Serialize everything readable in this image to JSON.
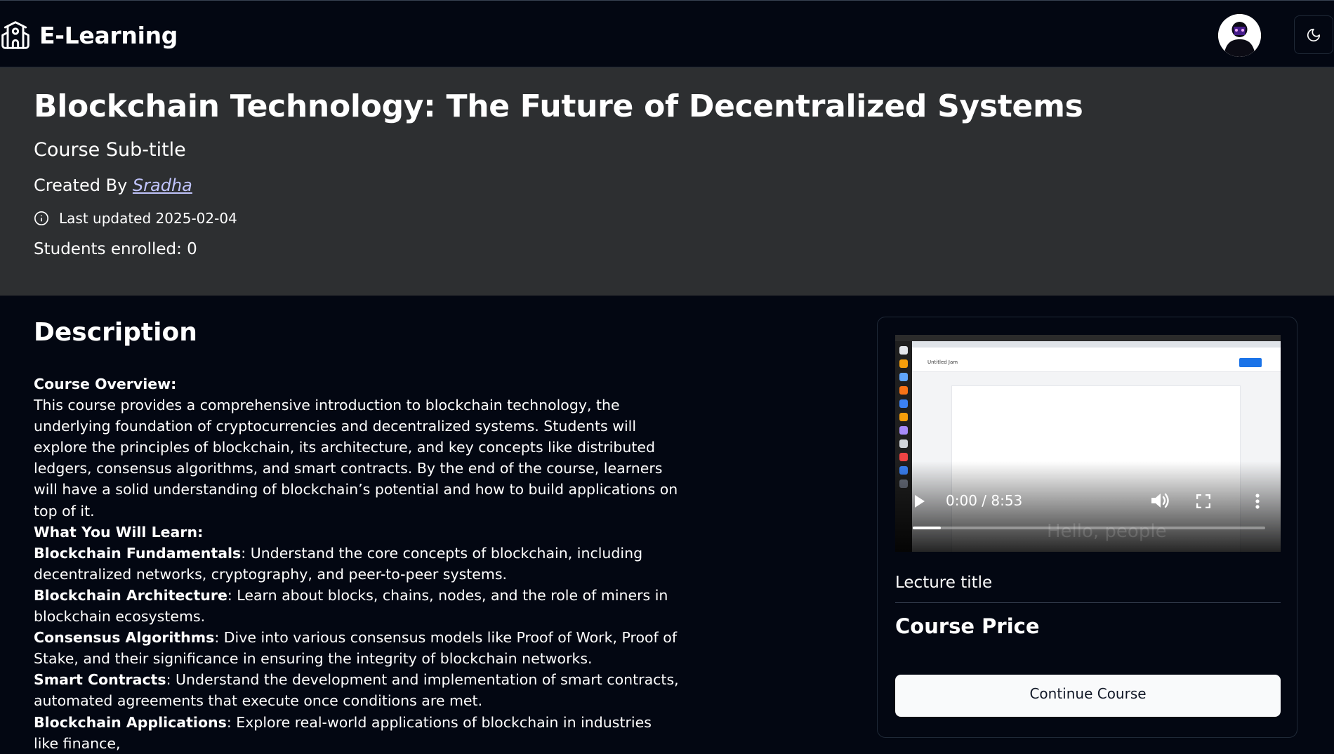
{
  "navbar": {
    "brand": "E-Learning",
    "brand_icon": "school-icon",
    "theme_icon": "moon-icon"
  },
  "course": {
    "title": "Blockchain Technology: The Future of Decentralized Systems",
    "subtitle": "Course Sub-title",
    "created_by_label": "Created By",
    "author": "Sradha",
    "last_updated": "Last updated 2025-02-04",
    "students_enrolled": "Students enrolled: 0"
  },
  "description": {
    "heading": "Description",
    "overview_label": "Course Overview:",
    "overview_text": "This course provides a comprehensive introduction to blockchain technology, the underlying foundation of cryptocurrencies and decentralized systems. Students will explore the principles of blockchain, its architecture, and key concepts like distributed ledgers, consensus algorithms, and smart contracts. By the end of the course, learners will have a solid understanding of blockchain’s potential and how to build applications on top of it.",
    "learn_label": "What You Will Learn:",
    "items": [
      {
        "term": "Blockchain Fundamentals",
        "text": ": Understand the core concepts of blockchain, including decentralized networks, cryptography, and peer-to-peer systems."
      },
      {
        "term": "Blockchain Architecture",
        "text": ": Learn about blocks, chains, nodes, and the role of miners in blockchain ecosystems."
      },
      {
        "term": "Consensus Algorithms",
        "text": ": Dive into various consensus models like Proof of Work, Proof of Stake, and their significance in ensuring the integrity of blockchain networks."
      },
      {
        "term": "Smart Contracts",
        "text": ": Understand the development and implementation of smart contracts, automated agreements that execute once conditions are met."
      },
      {
        "term": "Blockchain Applications",
        "text": ": Explore real-world applications of blockchain in industries like finance,"
      }
    ]
  },
  "sidebar": {
    "video": {
      "time": "0:00 / 8:53",
      "progress": 0.08,
      "caption": "Hello, people",
      "app_title": "Untitled Jam",
      "share_label": "Share"
    },
    "lecture_title": "Lecture title",
    "course_price": "Course Price",
    "continue_button": "Continue Course"
  }
}
